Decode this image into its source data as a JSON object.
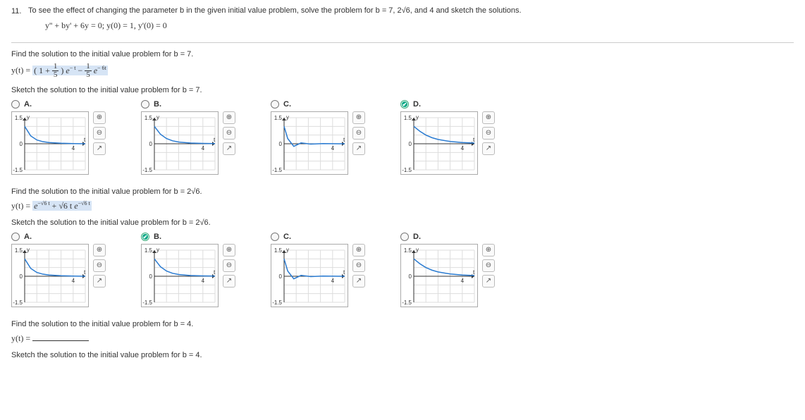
{
  "qnum": "11.",
  "intro": "To see the effect of changing the parameter b in the given initial value problem, solve the problem for b = 7, 2√6, and 4 and sketch the solutions.",
  "ode": "y'' + by' + 6y = 0;   y(0) = 1,   y'(0) = 0",
  "p1": {
    "find": "Find the solution to the initial value problem for b = 7.",
    "sketch": "Sketch the solution to the initial value problem for b = 7.",
    "optLabels": {
      "a": "A.",
      "b": "B.",
      "c": "C.",
      "d": "D."
    },
    "selected": "d"
  },
  "p2": {
    "find": "Find the solution to the initial value problem for b = 2√6.",
    "sketch": "Sketch the solution to the initial value problem for b = 2√6.",
    "optLabels": {
      "a": "A.",
      "b": "B.",
      "c": "C.",
      "d": "D."
    },
    "selected": "b"
  },
  "p3": {
    "find": "Find the solution to the initial value problem for b = 4.",
    "ylabel": "y(t) =",
    "sketch": "Sketch the solution to the initial value problem for b = 4."
  },
  "graph": {
    "ylabel": "y",
    "tlabel": "t",
    "yticks": [
      "1.5",
      "-1.5"
    ],
    "xtick": "4",
    "tick0": "0"
  },
  "tools": {
    "zoomin": "⊕",
    "zoomout": "⊖",
    "pop": "↗"
  },
  "chart_data": [
    {
      "id": "decay-fast",
      "type": "line",
      "title": "",
      "xlabel": "t",
      "ylabel": "y",
      "xlim": [
        0,
        5
      ],
      "ylim": [
        -1.5,
        1.5
      ],
      "x": [
        0,
        0.5,
        1,
        1.5,
        2,
        3,
        4,
        5
      ],
      "y": [
        1,
        0.45,
        0.22,
        0.12,
        0.07,
        0.03,
        0.01,
        0
      ]
    },
    {
      "id": "decay-mid",
      "type": "line",
      "title": "",
      "xlabel": "t",
      "ylabel": "y",
      "xlim": [
        0,
        5
      ],
      "ylim": [
        -1.5,
        1.5
      ],
      "x": [
        0,
        0.5,
        1,
        1.5,
        2,
        3,
        4,
        5
      ],
      "y": [
        1,
        0.55,
        0.3,
        0.17,
        0.1,
        0.04,
        0.02,
        0.01
      ]
    },
    {
      "id": "underdamp",
      "type": "line",
      "title": "",
      "xlabel": "t",
      "ylabel": "y",
      "xlim": [
        0,
        5
      ],
      "ylim": [
        -1.5,
        1.5
      ],
      "x": [
        0,
        0.3,
        0.8,
        1.4,
        2.2,
        3.2,
        4.5,
        5
      ],
      "y": [
        1,
        0.3,
        -0.15,
        0.05,
        -0.02,
        0.01,
        0,
        0
      ]
    },
    {
      "id": "decay-slow",
      "type": "line",
      "title": "",
      "xlabel": "t",
      "ylabel": "y",
      "xlim": [
        0,
        5
      ],
      "ylim": [
        -1.5,
        1.5
      ],
      "x": [
        0,
        0.5,
        1,
        1.5,
        2,
        3,
        4,
        5
      ],
      "y": [
        1,
        0.72,
        0.5,
        0.35,
        0.25,
        0.13,
        0.07,
        0.04
      ]
    }
  ]
}
